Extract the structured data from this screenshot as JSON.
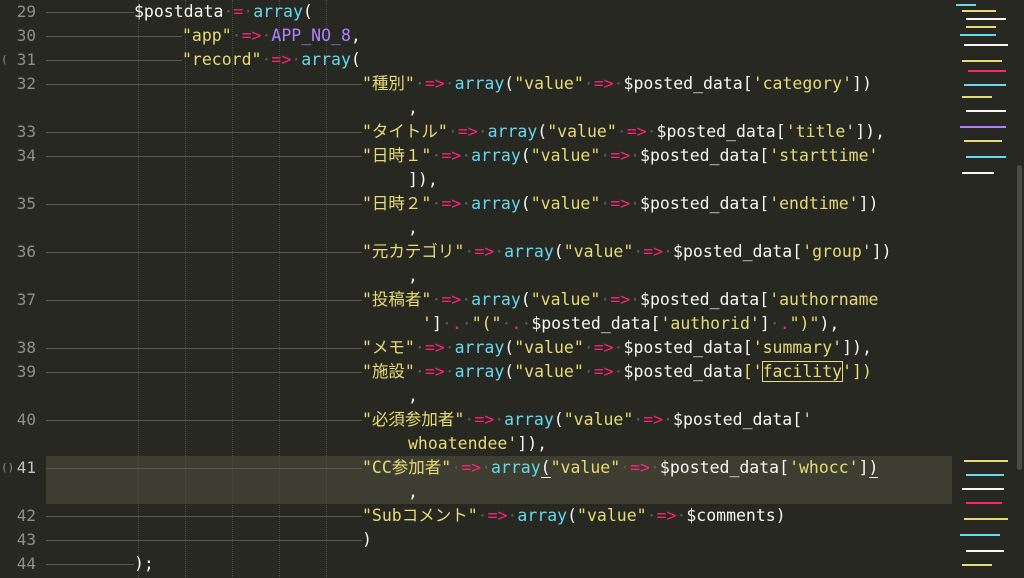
{
  "gutter": {
    "lines": [
      "29",
      "30",
      "31",
      "32",
      "",
      "33",
      "34",
      "",
      "35",
      "",
      "36",
      "",
      "37",
      "",
      "38",
      "39",
      "",
      "40",
      "",
      "41",
      "",
      "42",
      "43",
      "44"
    ]
  },
  "code": {
    "line29": {
      "var": "$postdata",
      "op": "=",
      "fn": "array",
      "p": "("
    },
    "line30": {
      "str": "\"app\"",
      "op": "=>",
      "const": "APP_NO_8",
      "p": ","
    },
    "line31": {
      "str": "\"record\"",
      "op": "=>",
      "fn": "array",
      "p": "("
    },
    "r32": {
      "key": "\"種別\"",
      "op": "=>",
      "fn": "array",
      "p1": "(",
      "vstr": "\"value\"",
      "op2": "=>",
      "var": "$posted_data",
      "b1": "[",
      "field": "'category'",
      "b2": "])",
      "tail": ","
    },
    "r33": {
      "key": "\"タイトル\"",
      "op": "=>",
      "fn": "array",
      "p1": "(",
      "vstr": "\"value\"",
      "op2": "=>",
      "var": "$posted_data",
      "b1": "[",
      "field": "'title'",
      "b2": "]),"
    },
    "r34": {
      "key": "\"日時１\"",
      "op": "=>",
      "fn": "array",
      "p1": "(",
      "vstr": "\"value\"",
      "op2": "=>",
      "var": "$posted_data",
      "b1": "[",
      "field": "'starttime'",
      "tail": "]),"
    },
    "r35": {
      "key": "\"日時２\"",
      "op": "=>",
      "fn": "array",
      "p1": "(",
      "vstr": "\"value\"",
      "op2": "=>",
      "var": "$posted_data",
      "b1": "[",
      "field": "'endtime'",
      "b2": "])",
      "tail": ","
    },
    "r36": {
      "key": "\"元カテゴリ\"",
      "op": "=>",
      "fn": "array",
      "p1": "(",
      "vstr": "\"value\"",
      "op2": "=>",
      "var": "$posted_data",
      "b1": "[",
      "field": "'group'",
      "b2": "])",
      "tail": ","
    },
    "r37": {
      "key": "\"投稿者\"",
      "op": "=>",
      "fn": "array",
      "p1": "(",
      "vstr": "\"value\"",
      "op2": "=>",
      "var": "$posted_data",
      "b1": "[",
      "field": "'authorname"
    },
    "r37b": {
      "q": "'",
      "b": "]",
      "dot": ".",
      "str": "\"(\"",
      "dot2": ".",
      "var": "$posted_data",
      "b1": "[",
      "field": "'authorid'",
      "b2": "]",
      "dot3": ".",
      "str2": "\")\"",
      "p": "),"
    },
    "r38": {
      "key": "\"メモ\"",
      "op": "=>",
      "fn": "array",
      "p1": "(",
      "vstr": "\"value\"",
      "op2": "=>",
      "var": "$posted_data",
      "b1": "[",
      "field": "'summary'",
      "b2": "]),"
    },
    "r39": {
      "key": "\"施設\"",
      "op": "=>",
      "fn": "array",
      "p1": "(",
      "vstr": "\"value\"",
      "op2": "=>",
      "var": "$posted_data",
      "b1": "['",
      "field": "facility",
      "b2": "'])",
      "tail": ","
    },
    "r40": {
      "key": "\"必須参加者\"",
      "op": "=>",
      "fn": "array",
      "p1": "(",
      "vstr": "\"value\"",
      "op2": "=>",
      "var": "$posted_data",
      "b1": "[",
      "field": "'",
      "tail": "whoatendee'",
      "tail2": "]),"
    },
    "r41": {
      "key": "\"CC参加者\"",
      "op": "=>",
      "fn": "array",
      "p1": "(",
      "vstr": "\"value\"",
      "op2": "=>",
      "var": "$posted_data",
      "b1": "[",
      "field": "'whocc'",
      "b2": "]",
      "b3": ")",
      "tail": ","
    },
    "r42": {
      "key": "\"Subコメント\"",
      "op": "=>",
      "fn": "array",
      "p1": "(",
      "vstr": "\"value\"",
      "op2": "=>",
      "var": "$comments",
      "p2": ")"
    },
    "r43": {
      "p": ")"
    },
    "r44": {
      "p": ");"
    }
  },
  "colors": {
    "background": "#272822",
    "keyword": "#f92672",
    "function": "#66d9ef",
    "string": "#e6db74",
    "constant": "#ae81ff",
    "text": "#f8f8f2",
    "gutter": "#90908a"
  }
}
